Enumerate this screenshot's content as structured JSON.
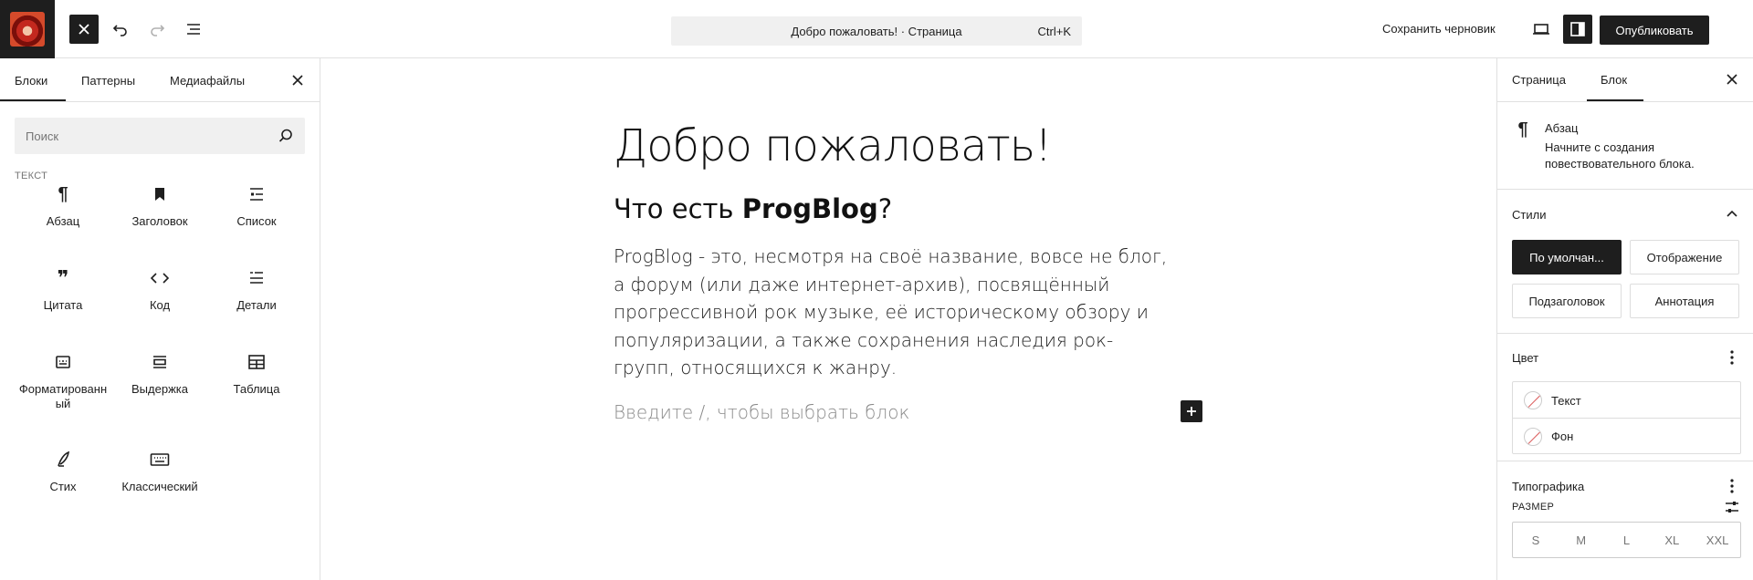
{
  "topbar": {
    "command_bar": {
      "title": "Добро пожаловать! · Страница",
      "shortcut": "Ctrl+K"
    },
    "save_draft_label": "Сохранить черновик",
    "publish_label": "Опубликовать"
  },
  "inserter": {
    "tabs": [
      {
        "label": "Блоки"
      },
      {
        "label": "Паттерны"
      },
      {
        "label": "Медиафайлы"
      }
    ],
    "search": {
      "placeholder": "Поиск",
      "value": ""
    },
    "category_label": "ТЕКСТ",
    "blocks": [
      {
        "label": "Абзац",
        "icon": "paragraph-icon"
      },
      {
        "label": "Заголовок",
        "icon": "bookmark-icon"
      },
      {
        "label": "Список",
        "icon": "list-icon"
      },
      {
        "label": "Цитата",
        "icon": "quote-icon"
      },
      {
        "label": "Код",
        "icon": "code-icon"
      },
      {
        "label": "Детали",
        "icon": "details-icon"
      },
      {
        "label": "Форматированный",
        "icon": "preformatted-icon"
      },
      {
        "label": "Выдержка",
        "icon": "pullquote-icon"
      },
      {
        "label": "Таблица",
        "icon": "table-icon"
      },
      {
        "label": "Стих",
        "icon": "verse-icon"
      },
      {
        "label": "Классический",
        "icon": "keyboard-icon"
      }
    ]
  },
  "canvas": {
    "title": "Добро пожаловать!",
    "heading_prefix": "Что есть ",
    "heading_bold": "ProgBlog",
    "heading_suffix": "?",
    "paragraph": "ProgBlog - это, несмотря на своё название, вовсе не блог, а форум (или даже интернет-архив), посвящённый прогрессивной рок музыке, её историческому обзору и популяризации, а также сохранения наследия рок-групп, относящихся к жанру.",
    "placeholder": "Введите /, чтобы выбрать блок"
  },
  "sidebar": {
    "tabs": [
      {
        "label": "Страница"
      },
      {
        "label": "Блок"
      }
    ],
    "block_card": {
      "title": "Абзац",
      "description": "Начните с создания повествовательного блока."
    },
    "styles": {
      "title": "Стили",
      "options": [
        {
          "label": "По умолчан..."
        },
        {
          "label": "Отображение"
        },
        {
          "label": "Подзаголовок"
        },
        {
          "label": "Аннотация"
        }
      ],
      "selected": "По умолчан..."
    },
    "color": {
      "title": "Цвет",
      "items": [
        {
          "label": "Текст"
        },
        {
          "label": "Фон"
        }
      ]
    },
    "typography": {
      "title": "Типографика",
      "size_label": "РАЗМЕР",
      "sizes": [
        {
          "label": "S"
        },
        {
          "label": "M"
        },
        {
          "label": "L"
        },
        {
          "label": "XL"
        },
        {
          "label": "XXL"
        }
      ]
    }
  },
  "colors": {
    "accent": "#1e1e1e",
    "border": "#e0e0e0",
    "muted": "#757575"
  }
}
